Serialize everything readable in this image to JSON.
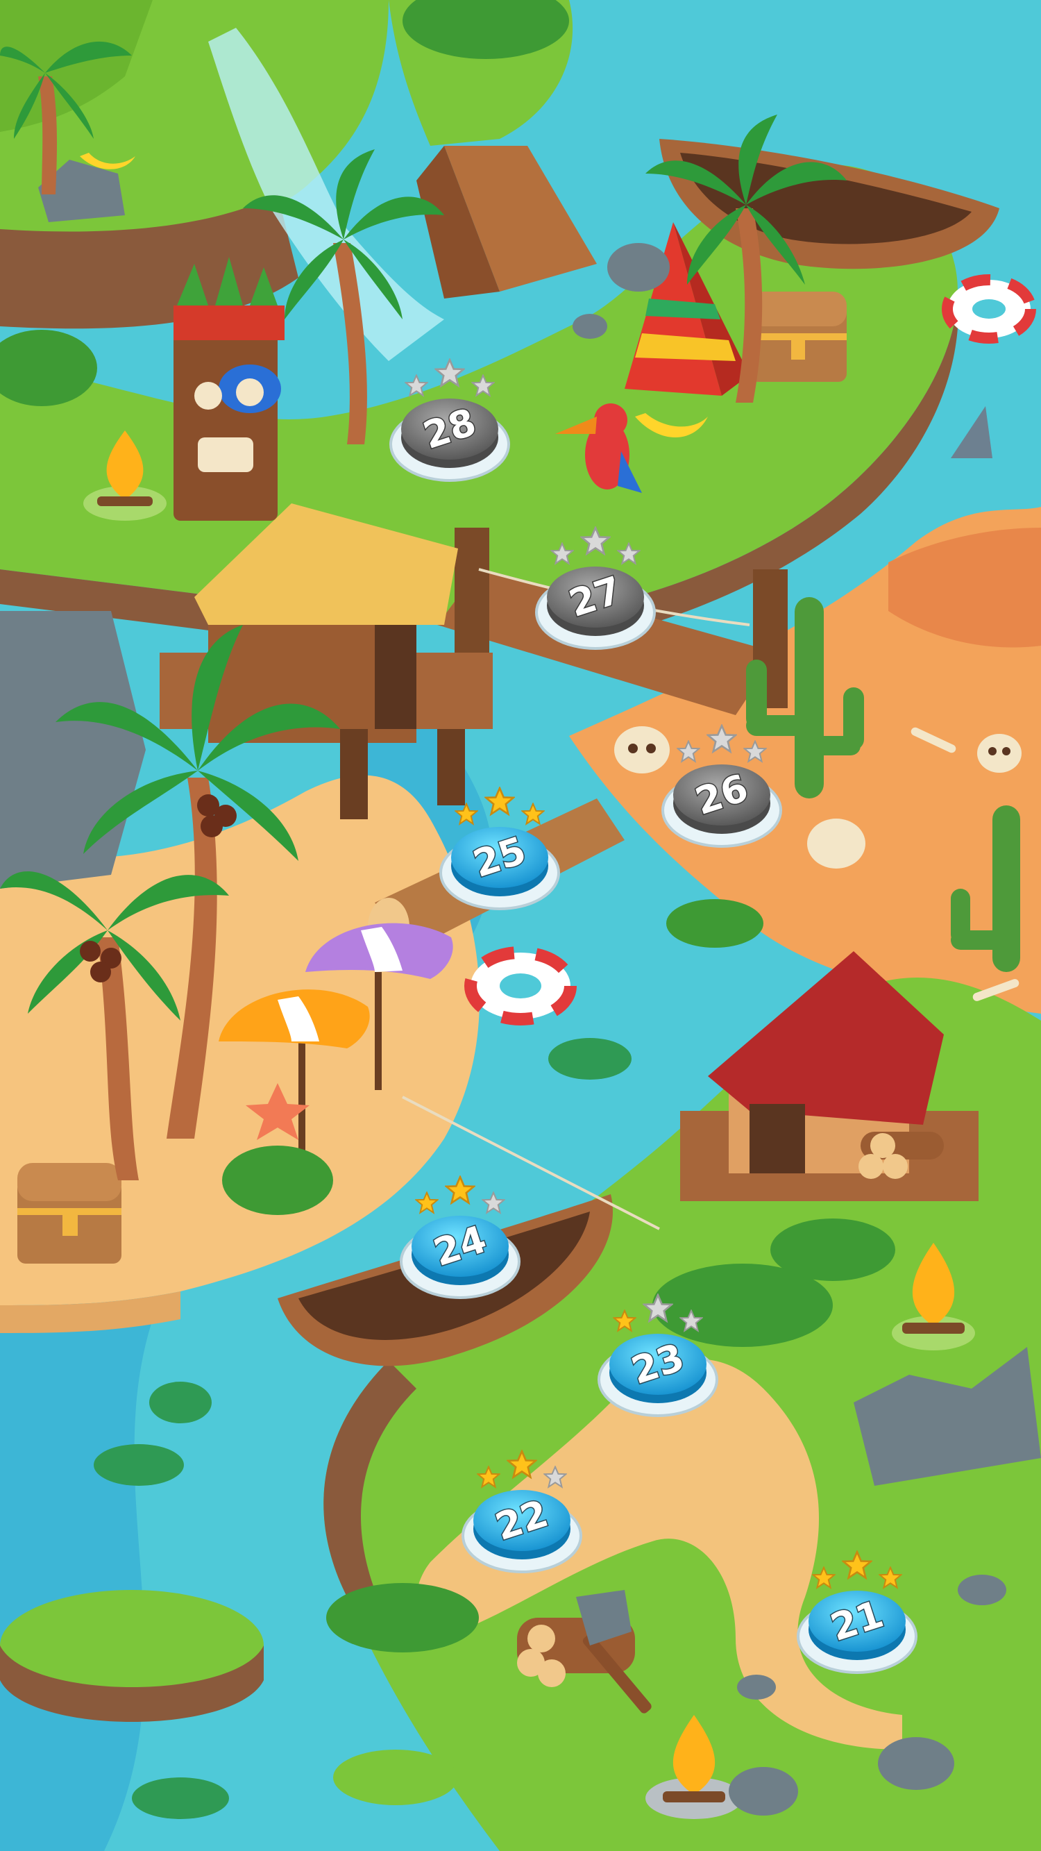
{
  "screen": "level-map",
  "levels": [
    {
      "number": "21",
      "stars": 3,
      "state": "completed"
    },
    {
      "number": "22",
      "stars": 2,
      "state": "completed"
    },
    {
      "number": "23",
      "stars": 1,
      "state": "completed"
    },
    {
      "number": "24",
      "stars": 2,
      "state": "completed"
    },
    {
      "number": "25",
      "stars": 3,
      "state": "completed"
    },
    {
      "number": "26",
      "stars": 0,
      "state": "locked"
    },
    {
      "number": "27",
      "stars": 0,
      "state": "locked"
    },
    {
      "number": "28",
      "stars": 0,
      "state": "locked"
    }
  ],
  "colors": {
    "water": "#4fc9d8",
    "water_deep": "#2fa6d6",
    "grass": "#7cc63a",
    "grass_dark": "#4e9a2a",
    "sand": "#f6c47e",
    "desert": "#f3a35a",
    "unlocked_button": "#1fa8e0",
    "locked_button": "#6e6e6e",
    "star_gold": "#ffc21a",
    "star_empty": "#d9d9d9"
  },
  "icons": [
    "palm-tree-icon",
    "tiki-totem-icon",
    "hut-icon",
    "boat-icon",
    "cactus-icon",
    "treasure-chest-icon",
    "life-ring-icon",
    "parrot-icon",
    "tent-icon",
    "campfire-icon",
    "umbrella-icon",
    "skull-icon",
    "axe-icon",
    "log-pile-icon",
    "rock-icon",
    "lily-pad-icon",
    "shark-fin-icon",
    "starfish-icon",
    "banana-icon",
    "cabin-icon"
  ]
}
